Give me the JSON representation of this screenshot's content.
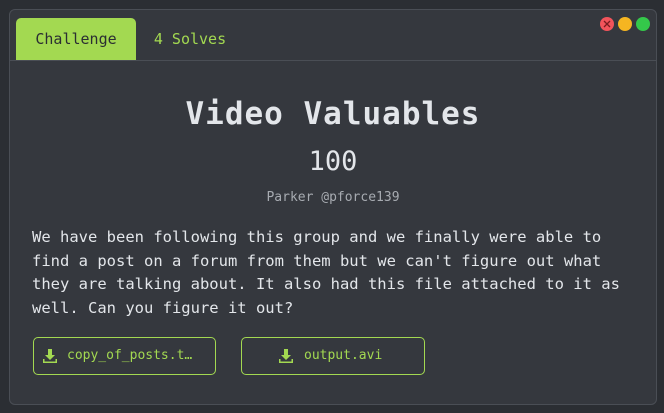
{
  "tabs": [
    {
      "label": "Challenge",
      "active": true
    },
    {
      "label": "4 Solves",
      "active": false
    }
  ],
  "challenge": {
    "title": "Video Valuables",
    "points": "100",
    "author": "Parker @pforce139",
    "description": "We have been following this group and we finally were able to find a post on a forum from them but we can't figure out what they are talking about. It also had this file attached to it as well. Can you figure it out?"
  },
  "files": [
    {
      "label": "copy_of_posts.t…",
      "icon": "download-icon"
    },
    {
      "label": "output.avi",
      "icon": "download-icon"
    }
  ],
  "window_controls": [
    "close",
    "minimize",
    "maximize"
  ],
  "colors": {
    "accent": "#a3d951",
    "background": "#35383e",
    "text": "#e3e6ea",
    "close": "#f2545b",
    "minimize": "#f5b521",
    "maximize": "#34c84a"
  }
}
